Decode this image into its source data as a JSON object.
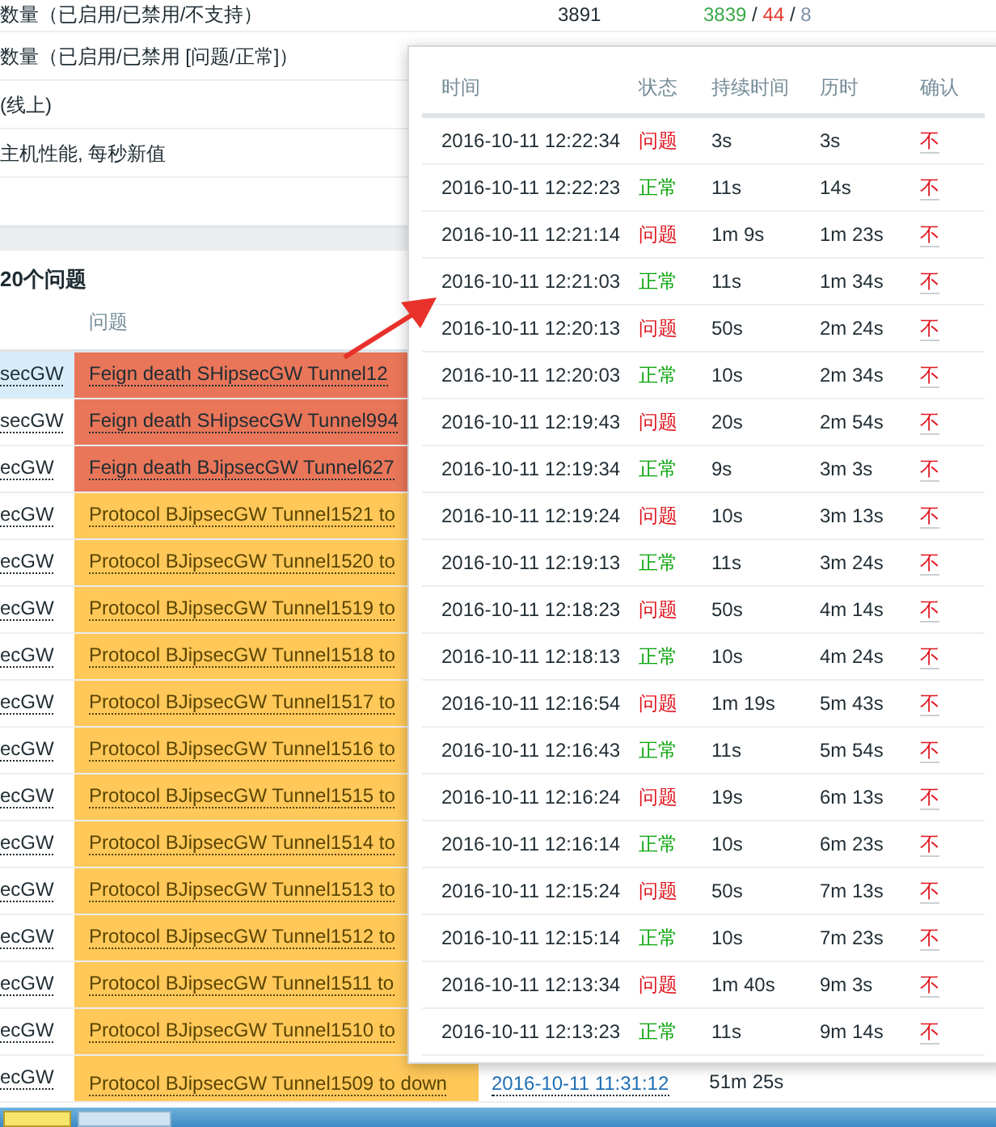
{
  "summary_rows": [
    {
      "label": "数量（已启用/已禁用/不支持）",
      "value": "3891",
      "parts": [
        {
          "text": "3839",
          "color": "#3aa84a"
        },
        {
          "text": "/",
          "color": "#1f2c33"
        },
        {
          "text": "44",
          "color": "#e33b2e"
        },
        {
          "text": "/",
          "color": "#1f2c33"
        },
        {
          "text": "8",
          "color": "#7f93a8"
        }
      ]
    },
    {
      "label": "数量（已启用/已禁用 [问题/正常]）"
    },
    {
      "label": "(线上)"
    },
    {
      "label": "主机性能, 每秒新值"
    }
  ],
  "problems_panel": {
    "title": "20个问题",
    "columns": [
      "问题"
    ],
    "rows": [
      {
        "host": "secGW",
        "problem": "Feign death SHipsecGW Tunnel12",
        "kind": "disaster",
        "highlighted": true
      },
      {
        "host": "secGW",
        "problem": "Feign death SHipsecGW Tunnel994",
        "kind": "disaster",
        "highlighted": false
      },
      {
        "host": "ecGW",
        "problem": "Feign death BJipsecGW Tunnel627",
        "kind": "disaster",
        "highlighted": false
      },
      {
        "host": "ecGW",
        "problem": "Protocol BJipsecGW Tunnel1521 to",
        "kind": "average",
        "highlighted": false
      },
      {
        "host": "ecGW",
        "problem": "Protocol BJipsecGW Tunnel1520 to",
        "kind": "average",
        "highlighted": false
      },
      {
        "host": "ecGW",
        "problem": "Protocol BJipsecGW Tunnel1519 to",
        "kind": "average",
        "highlighted": false
      },
      {
        "host": "ecGW",
        "problem": "Protocol BJipsecGW Tunnel1518 to",
        "kind": "average",
        "highlighted": false
      },
      {
        "host": "ecGW",
        "problem": "Protocol BJipsecGW Tunnel1517 to",
        "kind": "average",
        "highlighted": false
      },
      {
        "host": "ecGW",
        "problem": "Protocol BJipsecGW Tunnel1516 to",
        "kind": "average",
        "highlighted": false
      },
      {
        "host": "ecGW",
        "problem": "Protocol BJipsecGW Tunnel1515 to",
        "kind": "average",
        "highlighted": false
      },
      {
        "host": "ecGW",
        "problem": "Protocol BJipsecGW Tunnel1514 to",
        "kind": "average",
        "highlighted": false
      },
      {
        "host": "ecGW",
        "problem": "Protocol BJipsecGW Tunnel1513 to",
        "kind": "average",
        "highlighted": false
      },
      {
        "host": "ecGW",
        "problem": "Protocol BJipsecGW Tunnel1512 to",
        "kind": "average",
        "highlighted": false
      },
      {
        "host": "ecGW",
        "problem": "Protocol BJipsecGW Tunnel1511 to",
        "kind": "average",
        "highlighted": false
      },
      {
        "host": "ecGW",
        "problem": "Protocol BJipsecGW Tunnel1510 to",
        "kind": "average",
        "highlighted": false
      },
      {
        "host": "ecGW",
        "problem": "Protocol BJipsecGW Tunnel1509 to down",
        "kind": "average",
        "highlighted": false,
        "time": "2016-10-11 11:31:12",
        "duration": "51m 25s"
      }
    ]
  },
  "history_popup": {
    "columns": [
      "时间",
      "状态",
      "持续时间",
      "历时",
      "确认"
    ],
    "rows": [
      {
        "time": "2016-10-11 12:22:34",
        "status": "问题",
        "kind": "problem",
        "duration": "3s",
        "age": "3s",
        "ack": "不"
      },
      {
        "time": "2016-10-11 12:22:23",
        "status": "正常",
        "kind": "ok",
        "duration": "11s",
        "age": "14s",
        "ack": "不"
      },
      {
        "time": "2016-10-11 12:21:14",
        "status": "问题",
        "kind": "problem",
        "duration": "1m 9s",
        "age": "1m 23s",
        "ack": "不"
      },
      {
        "time": "2016-10-11 12:21:03",
        "status": "正常",
        "kind": "ok",
        "duration": "11s",
        "age": "1m 34s",
        "ack": "不"
      },
      {
        "time": "2016-10-11 12:20:13",
        "status": "问题",
        "kind": "problem",
        "duration": "50s",
        "age": "2m 24s",
        "ack": "不"
      },
      {
        "time": "2016-10-11 12:20:03",
        "status": "正常",
        "kind": "ok",
        "duration": "10s",
        "age": "2m 34s",
        "ack": "不"
      },
      {
        "time": "2016-10-11 12:19:43",
        "status": "问题",
        "kind": "problem",
        "duration": "20s",
        "age": "2m 54s",
        "ack": "不"
      },
      {
        "time": "2016-10-11 12:19:34",
        "status": "正常",
        "kind": "ok",
        "duration": "9s",
        "age": "3m 3s",
        "ack": "不"
      },
      {
        "time": "2016-10-11 12:19:24",
        "status": "问题",
        "kind": "problem",
        "duration": "10s",
        "age": "3m 13s",
        "ack": "不"
      },
      {
        "time": "2016-10-11 12:19:13",
        "status": "正常",
        "kind": "ok",
        "duration": "11s",
        "age": "3m 24s",
        "ack": "不"
      },
      {
        "time": "2016-10-11 12:18:23",
        "status": "问题",
        "kind": "problem",
        "duration": "50s",
        "age": "4m 14s",
        "ack": "不"
      },
      {
        "time": "2016-10-11 12:18:13",
        "status": "正常",
        "kind": "ok",
        "duration": "10s",
        "age": "4m 24s",
        "ack": "不"
      },
      {
        "time": "2016-10-11 12:16:54",
        "status": "问题",
        "kind": "problem",
        "duration": "1m 19s",
        "age": "5m 43s",
        "ack": "不"
      },
      {
        "time": "2016-10-11 12:16:43",
        "status": "正常",
        "kind": "ok",
        "duration": "11s",
        "age": "5m 54s",
        "ack": "不"
      },
      {
        "time": "2016-10-11 12:16:24",
        "status": "问题",
        "kind": "problem",
        "duration": "19s",
        "age": "6m 13s",
        "ack": "不"
      },
      {
        "time": "2016-10-11 12:16:14",
        "status": "正常",
        "kind": "ok",
        "duration": "10s",
        "age": "6m 23s",
        "ack": "不"
      },
      {
        "time": "2016-10-11 12:15:24",
        "status": "问题",
        "kind": "problem",
        "duration": "50s",
        "age": "7m 13s",
        "ack": "不"
      },
      {
        "time": "2016-10-11 12:15:14",
        "status": "正常",
        "kind": "ok",
        "duration": "10s",
        "age": "7m 23s",
        "ack": "不"
      },
      {
        "time": "2016-10-11 12:13:34",
        "status": "问题",
        "kind": "problem",
        "duration": "1m 40s",
        "age": "9m 3s",
        "ack": "不"
      },
      {
        "time": "2016-10-11 12:13:23",
        "status": "正常",
        "kind": "ok",
        "duration": "11s",
        "age": "9m 14s",
        "ack": "不"
      }
    ]
  }
}
